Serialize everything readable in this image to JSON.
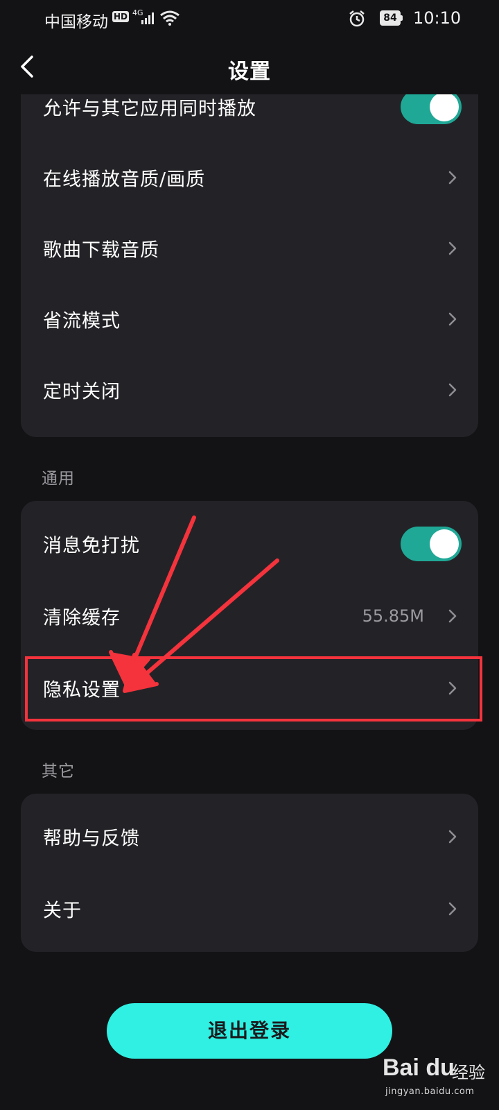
{
  "status_bar": {
    "carrier": "中国移动",
    "hd": "HD",
    "network": "4G",
    "battery": "84",
    "time": "10:10"
  },
  "header": {
    "title": "设置"
  },
  "playback_section": {
    "items": [
      {
        "label": "允许与其它应用同时播放",
        "type": "toggle",
        "on": true
      },
      {
        "label": "在线播放音质/画质",
        "type": "link"
      },
      {
        "label": "歌曲下载音质",
        "type": "link"
      },
      {
        "label": "省流模式",
        "type": "link"
      },
      {
        "label": "定时关闭",
        "type": "link"
      }
    ]
  },
  "general_section": {
    "title": "通用",
    "items": [
      {
        "label": "消息免打扰",
        "type": "toggle",
        "on": true
      },
      {
        "label": "清除缓存",
        "type": "link",
        "value": "55.85M"
      },
      {
        "label": "隐私设置",
        "type": "link"
      }
    ]
  },
  "other_section": {
    "title": "其它",
    "items": [
      {
        "label": "帮助与反馈",
        "type": "link"
      },
      {
        "label": "关于",
        "type": "link"
      }
    ]
  },
  "logout_button": {
    "label": "退出登录"
  },
  "watermark": {
    "brand": "Bai du",
    "text": "经验",
    "url": "jingyan.baidu.com"
  },
  "colors": {
    "background": "#131316",
    "card": "#232327",
    "toggle_on": "#1fa896",
    "logout": "#2ff0e2",
    "annotation": "#f4333c"
  }
}
